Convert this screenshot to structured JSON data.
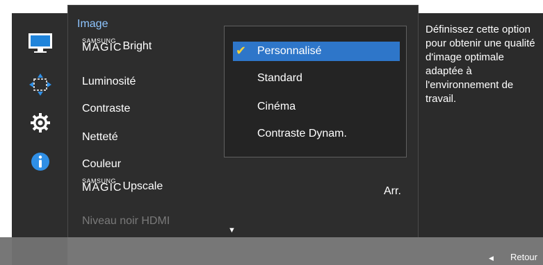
{
  "menu": {
    "title": "Image",
    "items": [
      {
        "brand_small": "SAMSUNG",
        "brand_big": "MAGIC",
        "label": "Bright"
      },
      {
        "label": "Luminosité"
      },
      {
        "label": "Contraste"
      },
      {
        "label": "Netteté"
      },
      {
        "label": "Couleur"
      },
      {
        "brand_small": "SAMSUNG",
        "brand_big": "MAGIC",
        "label": "Upscale",
        "value": "Arr."
      },
      {
        "label": "Niveau noir HDMI",
        "disabled": true
      }
    ]
  },
  "submenu": {
    "options": [
      {
        "label": "Personnalisé",
        "selected": true
      },
      {
        "label": "Standard"
      },
      {
        "label": "Cinéma"
      },
      {
        "label": "Contraste Dynam."
      }
    ]
  },
  "info": {
    "text": "Définissez cette option pour obtenir une qualité d'image optimale adaptée à l'environnement de travail."
  },
  "rail_icons": [
    "monitor-icon",
    "resize-arrows-icon",
    "gear-icon",
    "info-icon"
  ],
  "footer": {
    "back_label": "Retour"
  },
  "colors": {
    "accent": "#2e76c9",
    "title": "#8ec5ff",
    "check": "#f3d13a",
    "panel": "#2d2d2d",
    "bar": "#777777"
  }
}
